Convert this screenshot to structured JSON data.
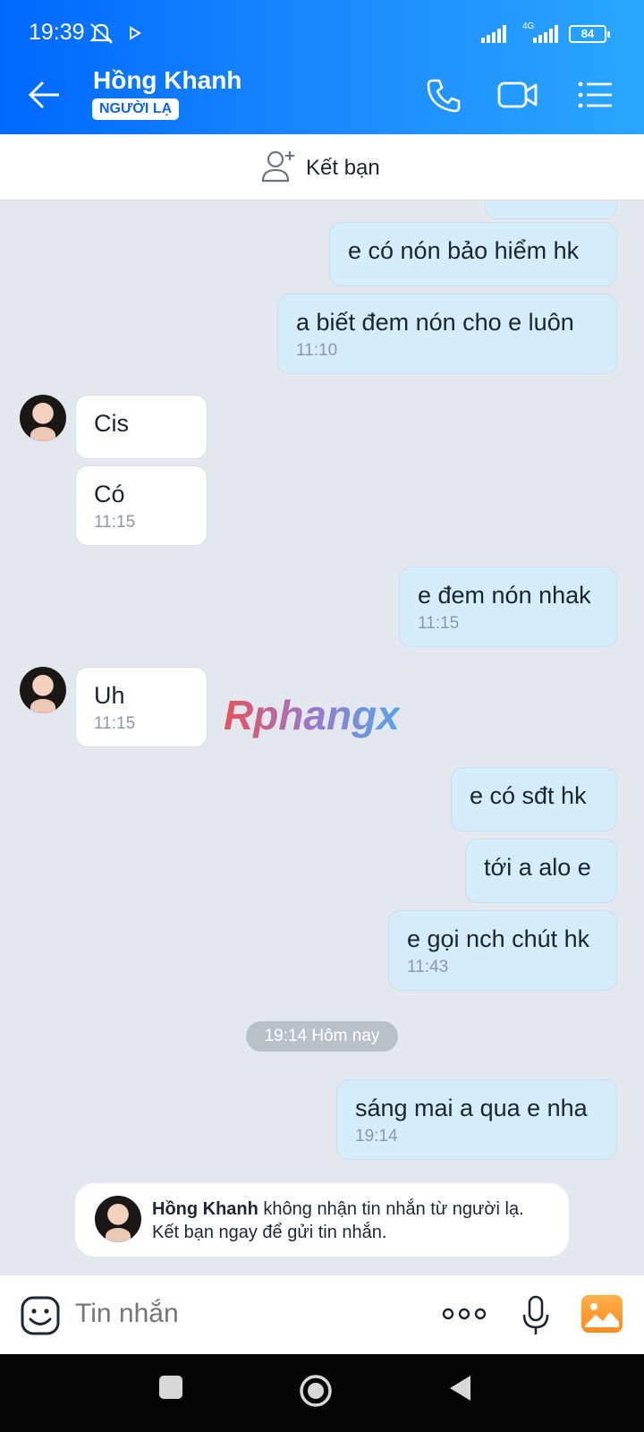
{
  "status": {
    "time": "19:39",
    "network": "4G",
    "battery": "84"
  },
  "header": {
    "title": "Hồng Khanh",
    "badge": "NGƯỜI LẠ"
  },
  "add_friend": {
    "label": "Kết bạn"
  },
  "messages": [
    {
      "from": "me",
      "text": "e có nón bảo hiểm hk",
      "time": ""
    },
    {
      "from": "me",
      "text": "a biết đem nón cho e luôn",
      "time": "11:10"
    },
    {
      "from": "them",
      "text": "Cis",
      "time": ""
    },
    {
      "from": "them",
      "text": "Có",
      "time": "11:15"
    },
    {
      "from": "me",
      "text": "e đem nón nhak",
      "time": "11:15"
    },
    {
      "from": "them",
      "text": "Uh",
      "time": "11:15"
    },
    {
      "from": "me",
      "text": "e có sđt hk",
      "time": ""
    },
    {
      "from": "me",
      "text": "tới a alo e",
      "time": ""
    },
    {
      "from": "me",
      "text": "e gọi nch chút hk",
      "time": "11:43"
    },
    {
      "from": "me",
      "text": "sáng mai a qua e nha",
      "time": "19:14"
    }
  ],
  "date_separator": "19:14 Hôm nay",
  "watermark": "Rphangx",
  "notice": {
    "name": "Hồng Khanh",
    "text": " không nhận tin nhắn từ người lạ.",
    "text2": "Kết bạn ngay để gửi tin nhắn."
  },
  "composer": {
    "placeholder": "Tin nhắn"
  },
  "colors": {
    "header_gradient_start": "#0068ff",
    "header_gradient_end": "#2aa6ff",
    "my_bubble": "#d5ecfb",
    "their_bubble": "#ffffff",
    "chat_bg": "#e2e8ee"
  }
}
